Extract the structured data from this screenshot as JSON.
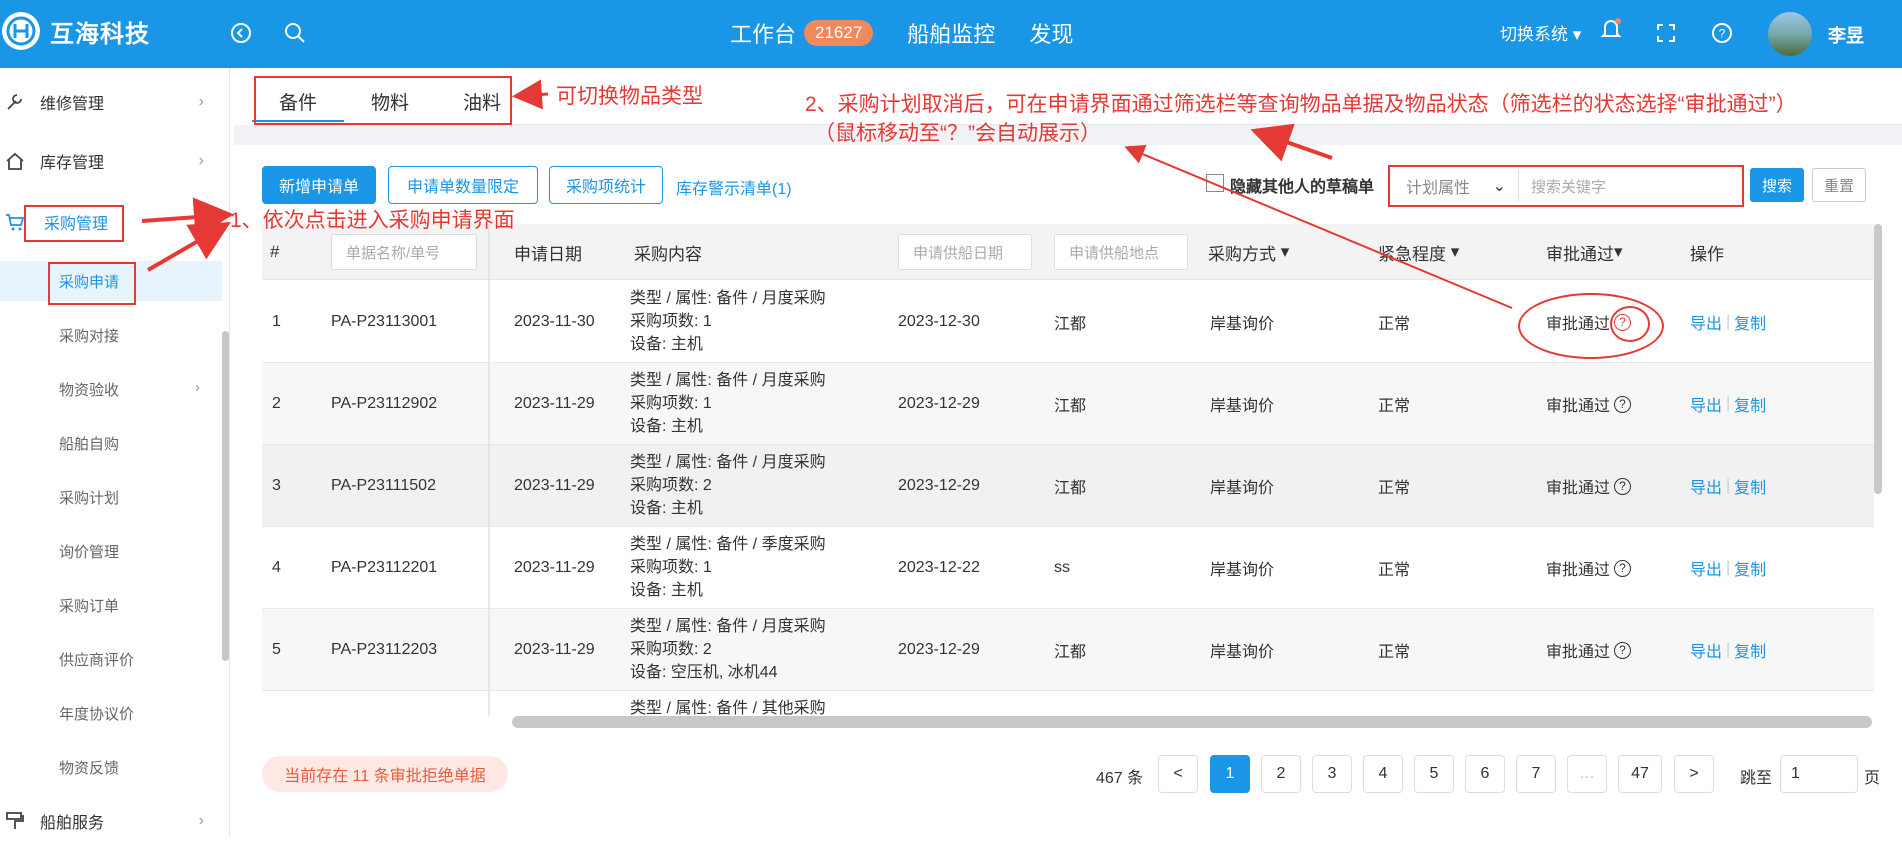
{
  "header": {
    "brand": "互海科技",
    "nav": [
      {
        "label": "工作台",
        "badge": "21627"
      },
      {
        "label": "船舶监控"
      },
      {
        "label": "发现"
      }
    ],
    "switch_system": "切换系统",
    "user_name": "李昱"
  },
  "sidebar": {
    "menus": [
      {
        "label": "维修管理"
      },
      {
        "label": "库存管理"
      },
      {
        "label": "采购管理"
      },
      {
        "label": "船舶服务"
      }
    ],
    "sub_items": [
      "采购申请",
      "采购对接",
      "物资验收",
      "船舶自购",
      "采购计划",
      "询价管理",
      "采购订单",
      "供应商评价",
      "年度协议价",
      "物资反馈"
    ]
  },
  "tabs": [
    "备件",
    "物料",
    "油料"
  ],
  "toolbar": {
    "new_request": "新增申请单",
    "quantity_limit": "申请单数量限定",
    "item_stats": "采购项统计",
    "stock_warning": "库存警示清单(1)",
    "hide_drafts": "隐藏其他人的草稿单",
    "plan_attr": "计划属性",
    "search_placeholder": "搜索关键字",
    "search": "搜索",
    "reset": "重置"
  },
  "table": {
    "headers": {
      "index": "#",
      "name_placeholder": "单据名称/单号",
      "apply_date": "申请日期",
      "content": "采购内容",
      "supply_date_placeholder": "申请供船日期",
      "supply_place_placeholder": "申请供船地点",
      "method": "采购方式",
      "urgency": "紧急程度",
      "status": "审批通过",
      "ops": "操作"
    },
    "rows": [
      {
        "idx": "1",
        "no": "PA-P23113001",
        "date": "2023-11-30",
        "c1": "类型 / 属性:  备件 / 月度采购",
        "c2": "采购项数:  1",
        "c3": "设备:   主机",
        "supply": "2023-12-30",
        "place": "江都",
        "method": "岸基询价",
        "urgency": "正常",
        "status": "审批通过",
        "export": "导出",
        "copy": "复制"
      },
      {
        "idx": "2",
        "no": "PA-P23112902",
        "date": "2023-11-29",
        "c1": "类型 / 属性:  备件 / 月度采购",
        "c2": "采购项数:  1",
        "c3": "设备:   主机",
        "supply": "2023-12-29",
        "place": "江都",
        "method": "岸基询价",
        "urgency": "正常",
        "status": "审批通过",
        "export": "导出",
        "copy": "复制"
      },
      {
        "idx": "3",
        "no": "PA-P23111502",
        "date": "2023-11-29",
        "c1": "类型 / 属性:  备件 / 月度采购",
        "c2": "采购项数:  2",
        "c3": "设备:   主机",
        "supply": "2023-12-29",
        "place": "江都",
        "method": "岸基询价",
        "urgency": "正常",
        "status": "审批通过",
        "export": "导出",
        "copy": "复制"
      },
      {
        "idx": "4",
        "no": "PA-P23112201",
        "date": "2023-11-29",
        "c1": "类型 / 属性:  备件 / 季度采购",
        "c2": "采购项数:  1",
        "c3": "设备:   主机",
        "supply": "2023-12-22",
        "place": "ss",
        "method": "岸基询价",
        "urgency": "正常",
        "status": "审批通过",
        "export": "导出",
        "copy": "复制"
      },
      {
        "idx": "5",
        "no": "PA-P23112203",
        "date": "2023-11-29",
        "c1": "类型 / 属性:  备件 / 月度采购",
        "c2": "采购项数:  2",
        "c3": "设备:   空压机, 冰机44",
        "supply": "2023-12-29",
        "place": "江都",
        "method": "岸基询价",
        "urgency": "正常",
        "status": "审批通过",
        "export": "导出",
        "copy": "复制"
      }
    ],
    "partial_row": "类型 / 属性:  备件 / 其他采购"
  },
  "footer": {
    "notice": "当前存在 11 条审批拒绝单据",
    "total": "467 条",
    "prev": "<",
    "pages": [
      "1",
      "2",
      "3",
      "4",
      "5",
      "6",
      "7",
      "…",
      "47"
    ],
    "next": ">",
    "jump_label": "跳至",
    "jump_value": "1",
    "page_unit": "页"
  },
  "annotations": {
    "a_tabs": "可切换物品类型",
    "a_step1": "1、依次点击进入采购申请界面",
    "a_step2_line1": "2、采购计划取消后，可在申请界面通过筛选栏等查询物品单据及物品状态（筛选栏的状态选择“审批通过”）",
    "a_step2_line2": "（鼠标移动至“？”会自动展示）"
  },
  "colors": {
    "primary": "#1a96e6",
    "annotation": "#e53935",
    "badge": "#f08a5d"
  }
}
